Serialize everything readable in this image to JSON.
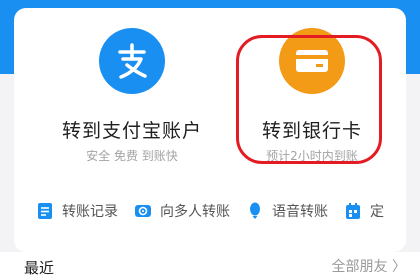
{
  "tiles": [
    {
      "title": "转到支付宝账户",
      "subtitle": "安全 免费 到账快",
      "icon": "alipay-logo-icon"
    },
    {
      "title": "转到银行卡",
      "subtitle": "预计2小时内到账",
      "icon": "bank-card-icon"
    }
  ],
  "quick_actions": [
    {
      "label": "转账记录",
      "icon": "record-list-icon"
    },
    {
      "label": "向多人转账",
      "icon": "multi-transfer-icon"
    },
    {
      "label": "语音转账",
      "icon": "microphone-icon"
    },
    {
      "label": "定",
      "icon": "calendar-icon"
    }
  ],
  "section": {
    "recent": "最近",
    "all_friends": "全部朋友 〉"
  },
  "colors": {
    "brand_blue": "#1a8ff2",
    "bank_orange": "#f39a16",
    "highlight_red": "#e31b23"
  }
}
